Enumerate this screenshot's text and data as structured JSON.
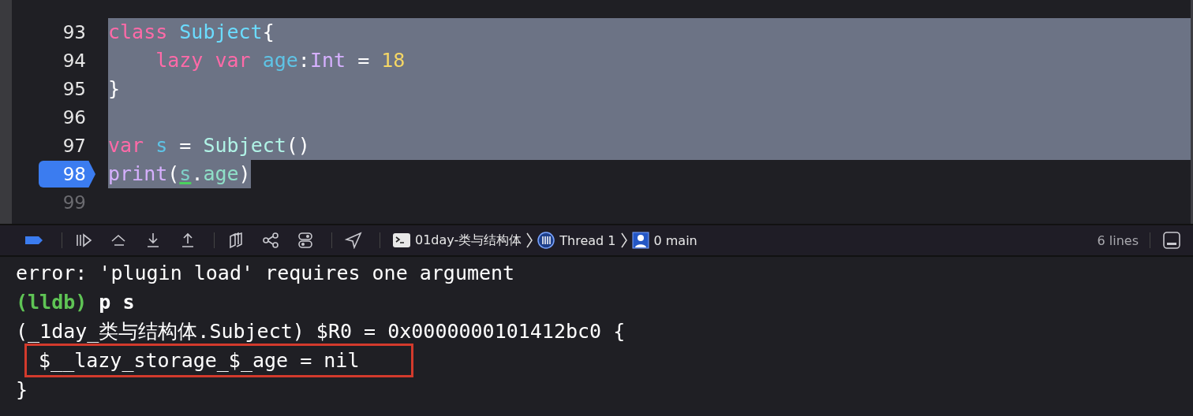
{
  "editor": {
    "lines": [
      {
        "number": "93",
        "selected": true,
        "breakpoint": false,
        "tokens": [
          {
            "text": "class",
            "kind": "keyword"
          },
          {
            "text": " Subject",
            "kind": "decl"
          },
          {
            "text": "{",
            "kind": "plain"
          }
        ]
      },
      {
        "number": "94",
        "selected": true,
        "breakpoint": false,
        "tokens": [
          {
            "text": "    lazy",
            "kind": "keyword"
          },
          {
            "text": " var",
            "kind": "keyword"
          },
          {
            "text": " age",
            "kind": "ident"
          },
          {
            "text": ":",
            "kind": "plain"
          },
          {
            "text": "Int",
            "kind": "builtin"
          },
          {
            "text": " =",
            "kind": "plain"
          },
          {
            "text": " 18",
            "kind": "number"
          }
        ]
      },
      {
        "number": "95",
        "selected": true,
        "breakpoint": false,
        "tokens": [
          {
            "text": "}",
            "kind": "plain"
          }
        ]
      },
      {
        "number": "96",
        "selected": true,
        "breakpoint": false
      },
      {
        "number": "97",
        "selected": true,
        "breakpoint": false,
        "tokens": [
          {
            "text": "var",
            "kind": "keyword"
          },
          {
            "text": " s",
            "kind": "ident"
          },
          {
            "text": " =",
            "kind": "plain"
          },
          {
            "text": " Subject",
            "kind": "typeref"
          },
          {
            "text": "()",
            "kind": "plain"
          }
        ]
      },
      {
        "number": "98",
        "selected": true,
        "breakpoint": true,
        "tokens": [
          {
            "text": "print",
            "kind": "builtin"
          },
          {
            "text": "(",
            "kind": "plain"
          },
          {
            "text": "s",
            "kind": "underlined"
          },
          {
            "text": ".",
            "kind": "plain"
          },
          {
            "text": "age",
            "kind": "member"
          },
          {
            "text": ")",
            "kind": "plain"
          }
        ]
      },
      {
        "number": "99",
        "selected": false,
        "breakpoint": false
      }
    ]
  },
  "debug_bar": {
    "breadcrumbs": [
      {
        "kind": "process",
        "label": "01day-类与结构体"
      },
      {
        "kind": "thread",
        "label": "Thread 1"
      },
      {
        "kind": "frame",
        "label": "0 main"
      }
    ],
    "line_count": "6 lines"
  },
  "console": {
    "lines": [
      {
        "highlighted": false,
        "segments": [
          {
            "text": "error: 'plugin load' requires one argument",
            "kind": "plain"
          }
        ]
      },
      {
        "highlighted": false,
        "segments": [
          {
            "text": "(lldb)",
            "kind": "prompt"
          },
          {
            "text": " p s",
            "kind": "command"
          }
        ]
      },
      {
        "highlighted": false,
        "segments": [
          {
            "text": "(_1day_类与结构体.Subject) $R0 = 0x0000000101412bc0 {",
            "kind": "plain"
          }
        ]
      },
      {
        "highlighted": true,
        "segments": [
          {
            "text": " $__lazy_storage_$_age = nil",
            "kind": "plain"
          }
        ]
      },
      {
        "highlighted": false,
        "segments": [
          {
            "text": "}",
            "kind": "plain"
          }
        ]
      }
    ]
  }
}
